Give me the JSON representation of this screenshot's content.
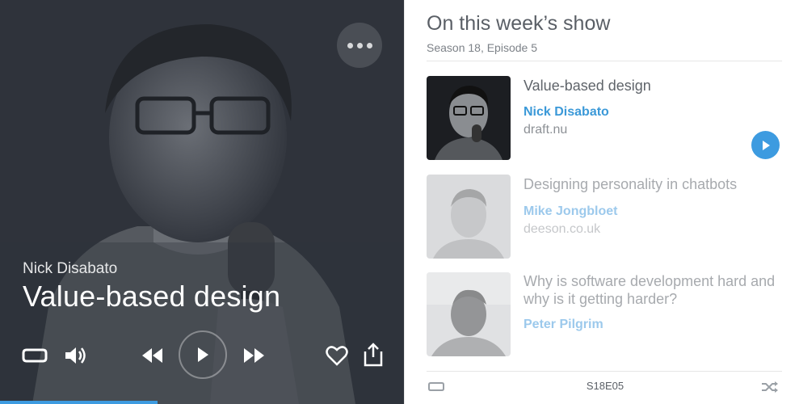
{
  "player": {
    "speaker": "Nick Disabato",
    "title": "Value-based design",
    "progress_percent": 39
  },
  "panel": {
    "heading": "On this week’s show",
    "season_episode": "Season 18, Episode 5",
    "episodes": [
      {
        "title": "Value-based design",
        "speaker": "Nick Disabato",
        "site": "draft.nu"
      },
      {
        "title": "Designing personality in chatbots",
        "speaker": "Mike Jongbloet",
        "site": "deeson.co.uk"
      },
      {
        "title": "Why is software development hard and why is it getting harder?",
        "speaker": "Peter Pilgrim",
        "site": ""
      }
    ],
    "footer_code": "S18E05"
  },
  "colors": {
    "accent": "#3d9be0",
    "player_bg": "#2f333b"
  },
  "icons": [
    "more-icon",
    "repeat-icon",
    "volume-icon",
    "rewind-icon",
    "play-icon",
    "fast-forward-icon",
    "heart-icon",
    "share-icon",
    "shuffle-icon"
  ]
}
